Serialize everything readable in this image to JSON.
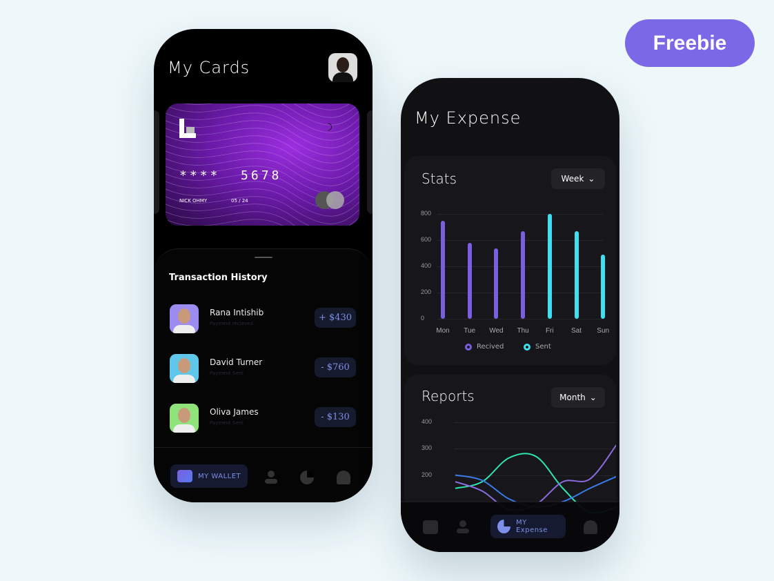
{
  "badge": "Freebie",
  "wallet": {
    "title": "My Cards",
    "card": {
      "number": "****  5678",
      "holder": "NICK OHMY",
      "expiry": "05 / 24"
    },
    "history_title": "Transaction History",
    "transactions": [
      {
        "name": "Rana Intishib",
        "sub": "Payment recieved",
        "amount": "+ $430",
        "avatar_bg": "#9d8cf0"
      },
      {
        "name": "David Turner",
        "sub": "Payment Sent",
        "amount": "- $760",
        "avatar_bg": "#5fc8ea"
      },
      {
        "name": "Oliva James",
        "sub": "Payment Sent",
        "amount": "- $130",
        "avatar_bg": "#8fe37a"
      }
    ],
    "nav": {
      "active": "MY WALLET",
      "icons": [
        "wallet-icon",
        "user-icon",
        "pie-chart-icon",
        "bell-icon"
      ]
    }
  },
  "expense": {
    "title": "My Expense",
    "stats": {
      "title": "Stats",
      "period": "Week"
    },
    "reports": {
      "title": "Reports",
      "period": "Month"
    },
    "nav": {
      "active": "MY Expense",
      "icons": [
        "wallet-icon",
        "user-icon",
        "pie-chart-icon",
        "bell-icon"
      ]
    }
  },
  "chart_data": [
    {
      "type": "bar",
      "title": "Stats",
      "categories": [
        "Mon",
        "Tue",
        "Wed",
        "Thu",
        "Fri",
        "Sat",
        "Sun"
      ],
      "values": [
        750,
        580,
        535,
        670,
        800,
        670,
        490
      ],
      "series_of_bar": [
        "Recived",
        "Recived",
        "Recived",
        "Recived",
        "Sent",
        "Sent",
        "Sent"
      ],
      "legend": [
        {
          "name": "Recived",
          "color": "#7a5fe0"
        },
        {
          "name": "Sent",
          "color": "#3ee0f0"
        }
      ],
      "yticks": [
        0,
        200,
        400,
        600,
        800
      ],
      "ylim": [
        0,
        800
      ],
      "grid": true,
      "legend_placement": "bottom"
    },
    {
      "type": "line",
      "title": "Reports",
      "yticks": [
        200,
        300,
        400
      ],
      "ylim": [
        100,
        400
      ],
      "grid": true,
      "x": [
        0,
        1,
        2,
        3,
        4,
        5,
        6
      ],
      "series": [
        {
          "color": "#2ee6b0",
          "values": [
            150,
            175,
            265,
            270,
            150,
            60,
            80
          ]
        },
        {
          "color": "#3a7ae8",
          "values": [
            200,
            180,
            110,
            80,
            100,
            150,
            195
          ]
        },
        {
          "color": "#8a6ce0",
          "values": [
            175,
            140,
            70,
            90,
            175,
            185,
            315
          ]
        }
      ]
    }
  ]
}
